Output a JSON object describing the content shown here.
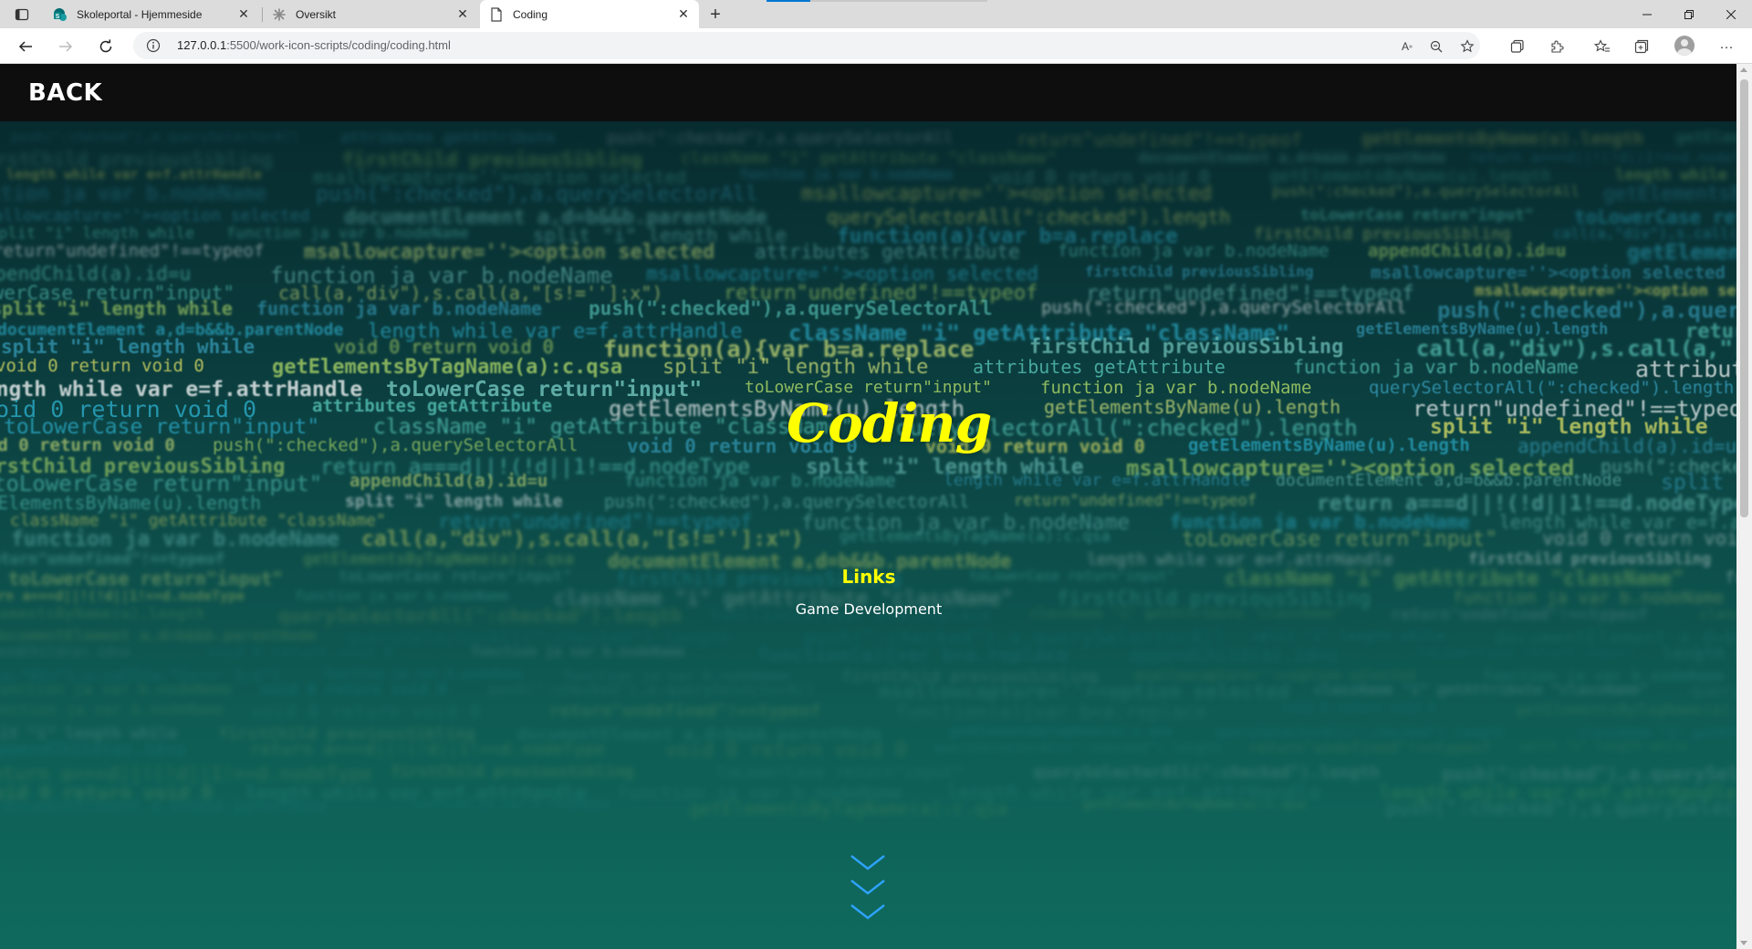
{
  "browser": {
    "tabs": [
      {
        "title": "Skoleportal - Hjemmeside",
        "icon": "sharepoint-icon"
      },
      {
        "title": "Oversikt",
        "icon": "canvas-icon"
      },
      {
        "title": "Coding",
        "icon": "page-icon",
        "active": true
      }
    ],
    "url_host": "127.0.0.1",
    "url_rest": ":5500/work-icon-scripts/coding/coding.html"
  },
  "page": {
    "back_label": "BACK",
    "hero_title": "Coding",
    "links_heading": "Links",
    "links": [
      "Game Development"
    ]
  },
  "colors": {
    "accent": "#ffff00",
    "topbar": "#0e0e0e",
    "bg_top": "#06272b",
    "bg_bottom": "#0f6a5d"
  }
}
